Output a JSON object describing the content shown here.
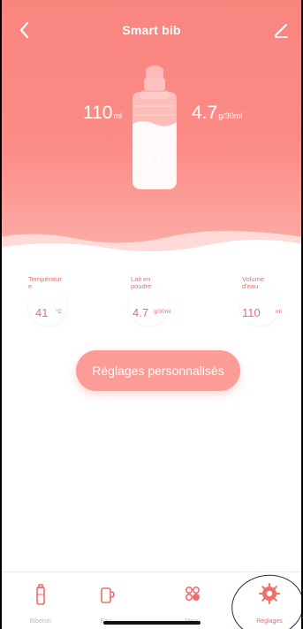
{
  "header": {
    "title": "Smart bib",
    "back_icon": "chevron-left-icon",
    "edit_icon": "pencil-icon"
  },
  "bottle": {
    "volume_value": "110",
    "volume_unit": "ml",
    "powder_value": "4.7",
    "powder_unit": "g/30ml",
    "temp_value": "41",
    "temp_unit": "°C"
  },
  "stats": [
    {
      "label": "Températur\ne",
      "value": "41",
      "unit": "°C"
    },
    {
      "label": "Lait en\npoudre",
      "value": "4.7",
      "unit": "g/30ml"
    },
    {
      "label": "Volume\nd'eau",
      "value": "110",
      "unit": "ml"
    }
  ],
  "cta": {
    "label": "Réglages personnalisés"
  },
  "tabs": [
    {
      "label": "Biberon",
      "icon": "bottle-icon",
      "active": false
    },
    {
      "label": "Eau",
      "icon": "cup-icon",
      "active": false
    },
    {
      "label": "Menu",
      "icon": "menu-grid-icon",
      "active": false
    },
    {
      "label": "Réglages",
      "icon": "gear-icon",
      "active": true
    }
  ],
  "colors": {
    "accent": "#f06d6a",
    "hero": "#fb8b86",
    "button": "#fb9c96"
  }
}
